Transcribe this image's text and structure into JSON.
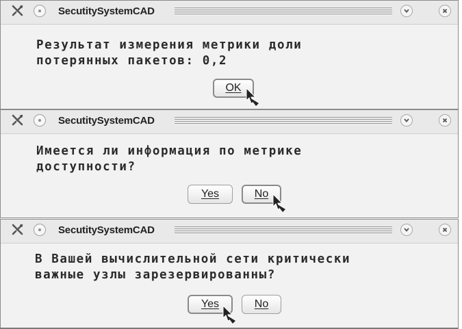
{
  "dialogs": [
    {
      "title": "SecutitySystemCAD",
      "message_lines": [
        "Результат измерения метрики доли",
        "потерянных пакетов: 0,2"
      ],
      "buttons": [
        "OK"
      ]
    },
    {
      "title": "SecutitySystemCAD",
      "message_lines": [
        "Имеется ли информация по метрике",
        "доступности?"
      ],
      "buttons": [
        "Yes",
        "No"
      ]
    },
    {
      "title": "SecutitySystemCAD",
      "message_lines": [
        "В Вашей вычислительной сети критически",
        "важные узлы зарезервированны?"
      ],
      "buttons": [
        "Yes",
        "No"
      ]
    }
  ],
  "icons": {
    "menu": "window-menu-icon",
    "pin": "pin-icon",
    "rollup": "chevron-down-icon",
    "close": "close-icon",
    "pointer": "hand-pointer-icon"
  }
}
